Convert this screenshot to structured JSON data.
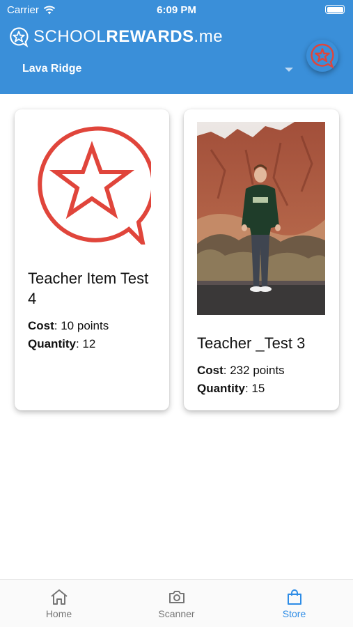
{
  "status_bar": {
    "carrier": "Carrier",
    "time": "6:09 PM"
  },
  "header": {
    "brand_light": "SCHOOL",
    "brand_bold": "REWARDS",
    "brand_suffix": ".me",
    "school": "Lava Ridge",
    "fab_icon": "star-chat-icon"
  },
  "colors": {
    "header_bg": "#3a8fd9",
    "accent_red": "#e0453b",
    "active_tab": "#2d8ce6"
  },
  "items": [
    {
      "title": "Teacher Item Test 4",
      "cost_label": "Cost",
      "cost_value": ": 10 points",
      "qty_label": "Quantity",
      "qty_value": ": 12",
      "image": "star-chat-logo"
    },
    {
      "title": "Teacher _Test 3",
      "cost_label": "Cost",
      "cost_value": ": 232 points",
      "qty_label": "Quantity",
      "qty_value": ": 15",
      "image": "photo-person-red-rocks"
    }
  ],
  "tabs": [
    {
      "label": "Home",
      "icon": "home-icon"
    },
    {
      "label": "Scanner",
      "icon": "camera-icon"
    },
    {
      "label": "Store",
      "icon": "shopping-bag-icon",
      "active": true
    }
  ]
}
